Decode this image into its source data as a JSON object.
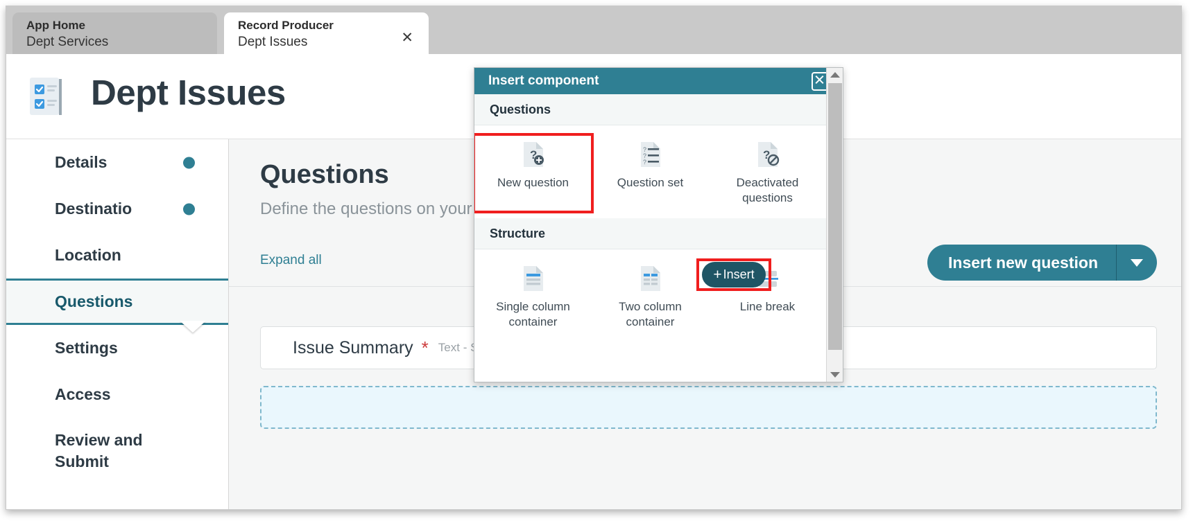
{
  "tabs": [
    {
      "type_label": "App Home",
      "name": "Dept Services",
      "active": false,
      "closable": false
    },
    {
      "type_label": "Record Producer",
      "name": "Dept Issues",
      "active": true,
      "closable": true
    }
  ],
  "header": {
    "title": "Dept Issues",
    "icon": "checklist-document-icon"
  },
  "sidebar": {
    "items": [
      {
        "label": "Details",
        "dot": true,
        "active": false
      },
      {
        "label": "Destinatio",
        "dot": true,
        "active": false
      },
      {
        "label": "Location",
        "dot": false,
        "active": false
      },
      {
        "label": "Questions",
        "dot": false,
        "active": true
      },
      {
        "label": "Settings",
        "dot": false,
        "active": false
      },
      {
        "label": "Access",
        "dot": false,
        "active": false
      },
      {
        "label": "Review and Submit",
        "dot": false,
        "active": false
      }
    ]
  },
  "main": {
    "title": "Questions",
    "subtitle": "Define the questions on your i",
    "expand_all": "Expand all",
    "insert_new_question": "Insert new question",
    "question_row": {
      "label": "Issue Summary",
      "required_marker": "*",
      "type": "Text - Sin"
    },
    "insert_pill": {
      "plus": "+",
      "label": "Insert"
    }
  },
  "modal": {
    "title": "Insert component",
    "close_icon": "close-icon",
    "sections": [
      {
        "heading": "Questions",
        "items": [
          {
            "label": "New question",
            "icon": "question-add-icon",
            "selected": true
          },
          {
            "label": "Question set",
            "icon": "question-list-icon",
            "selected": false
          },
          {
            "label": "Deactivated questions",
            "icon": "question-disabled-icon",
            "selected": false
          }
        ]
      },
      {
        "heading": "Structure",
        "items": [
          {
            "label": "Single column container",
            "icon": "single-column-icon",
            "selected": false
          },
          {
            "label": "Two column container",
            "icon": "two-column-icon",
            "selected": false
          },
          {
            "label": "Line break",
            "icon": "line-break-icon",
            "selected": false
          }
        ]
      }
    ],
    "scrollbar": {
      "up_icon": "scroll-up-arrow-icon",
      "down_icon": "scroll-down-arrow-icon"
    }
  },
  "colors": {
    "accent_teal": "#2f7f93",
    "dark_teal": "#1f5565",
    "highlight_red": "#f01e1e",
    "required_red": "#cc3b3b",
    "dropzone_blue": "#eaf7fd",
    "icon_blue": "#3d9ae0"
  }
}
